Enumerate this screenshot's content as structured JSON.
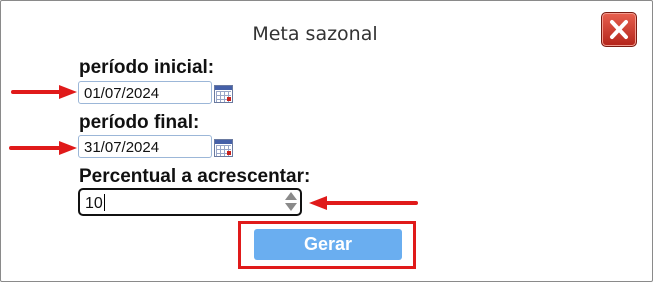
{
  "dialog": {
    "title": "Meta sazonal",
    "close_icon": "close-x-icon",
    "colors": {
      "close": "#c9392c",
      "button": "#6aaef0",
      "highlight": "#e01a1a"
    }
  },
  "form": {
    "start_label": "período inicial:",
    "start_value": "01/07/2024",
    "end_label": "período final:",
    "end_value": "31/07/2024",
    "percent_label": "Percentual a acrescentar:",
    "percent_value": "10",
    "calendar_icon": "calendar-icon",
    "submit_label": "Gerar"
  }
}
